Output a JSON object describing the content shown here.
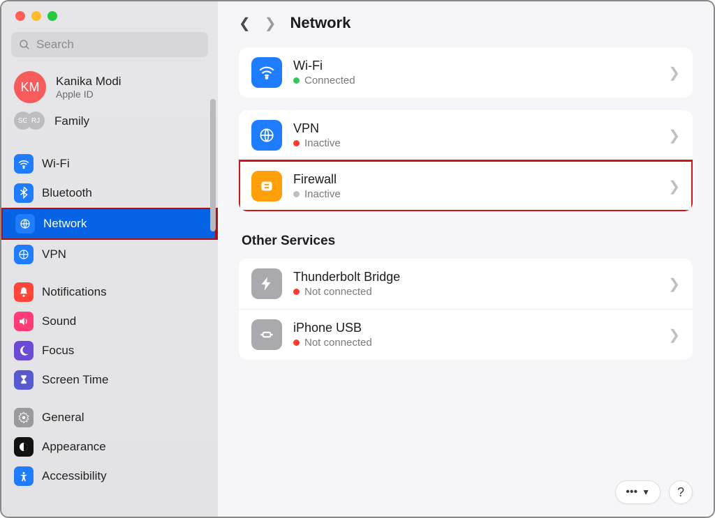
{
  "window": {
    "search_placeholder": "Search"
  },
  "user": {
    "initials": "KM",
    "name": "Kanika Modi",
    "sub": "Apple ID"
  },
  "family": {
    "label": "Family",
    "av1": "SG",
    "av2": "RJ"
  },
  "sidebar": {
    "items": [
      {
        "label": "Wi-Fi"
      },
      {
        "label": "Bluetooth"
      },
      {
        "label": "Network"
      },
      {
        "label": "VPN"
      },
      {
        "label": "Notifications"
      },
      {
        "label": "Sound"
      },
      {
        "label": "Focus"
      },
      {
        "label": "Screen Time"
      },
      {
        "label": "General"
      },
      {
        "label": "Appearance"
      },
      {
        "label": "Accessibility"
      }
    ]
  },
  "header": {
    "title": "Network"
  },
  "rows": {
    "wifi": {
      "title": "Wi-Fi",
      "status": "Connected"
    },
    "vpn": {
      "title": "VPN",
      "status": "Inactive"
    },
    "firewall": {
      "title": "Firewall",
      "status": "Inactive"
    },
    "section_other": "Other Services",
    "tbridge": {
      "title": "Thunderbolt Bridge",
      "status": "Not connected"
    },
    "iphoneusb": {
      "title": "iPhone USB",
      "status": "Not connected"
    }
  },
  "footer": {
    "more": "•••",
    "help": "?"
  }
}
